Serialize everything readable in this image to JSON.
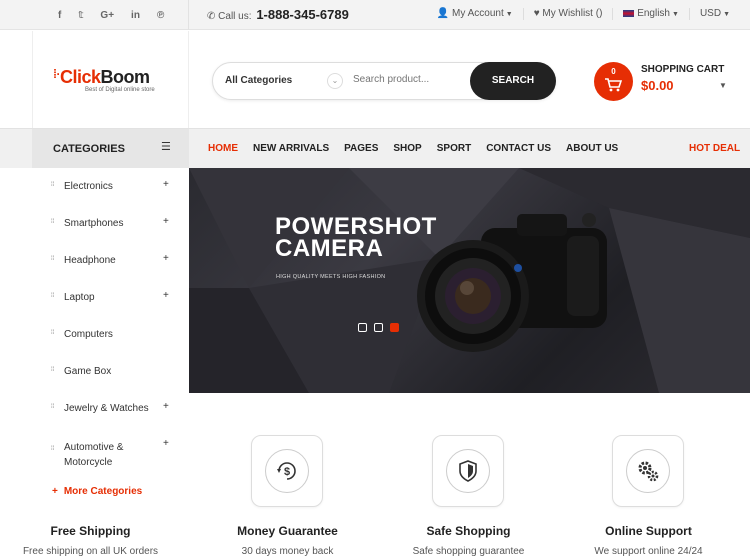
{
  "topbar": {
    "socials": [
      "f",
      "𝕥",
      "G+",
      "in",
      "℗"
    ],
    "call_label": "Call us:",
    "phone": "1-888-345-6789",
    "my_account": "My Account",
    "wishlist": "My Wishlist ()",
    "language": "English",
    "currency": "USD"
  },
  "header": {
    "logo_red": "Click",
    "logo_dark": "Boom",
    "tagline": "Best of Digital online store",
    "search": {
      "category": "All Categories",
      "placeholder": "Search product...",
      "button": "SEARCH"
    },
    "cart": {
      "count": "0",
      "title": "SHOPPING CART",
      "total": "$0.00"
    }
  },
  "nav": {
    "categories_title": "CATEGORIES",
    "items": [
      "HOME",
      "NEW ARRIVALS",
      "PAGES",
      "SHOP",
      "SPORT",
      "CONTACT US",
      "ABOUT US"
    ],
    "hot_deal": "HOT DEAL"
  },
  "sidebar": {
    "items": [
      {
        "label": "Electronics",
        "expand": "+"
      },
      {
        "label": "Smartphones",
        "expand": "+"
      },
      {
        "label": "Headphone",
        "expand": "+"
      },
      {
        "label": "Laptop",
        "expand": "+"
      },
      {
        "label": "Computers",
        "expand": ""
      },
      {
        "label": "Game Box",
        "expand": ""
      },
      {
        "label": "Jewelry & Watches",
        "expand": "+"
      },
      {
        "label": "Automotive & Motorcycle",
        "expand": "+"
      }
    ],
    "more": "More Categories"
  },
  "banner": {
    "title_line1": "POWERSHOT",
    "title_line2": "CAMERA",
    "subtitle": "HIGH QUALITY MEETS HIGH FASHION",
    "slides": 3,
    "active_slide": 3
  },
  "features": [
    {
      "icon": "dollar-refresh-icon",
      "title": "Free Shipping",
      "subtitle": "Free shipping on all UK orders"
    },
    {
      "icon": "money-icon",
      "title": "Money Guarantee",
      "subtitle": "30 days money back"
    },
    {
      "icon": "shield-icon",
      "title": "Safe Shopping",
      "subtitle": "Safe shopping guarantee"
    },
    {
      "icon": "gears-icon",
      "title": "Online Support",
      "subtitle": "We support online 24/24"
    }
  ],
  "colors": {
    "accent": "#e62e04",
    "dark": "#222222"
  }
}
